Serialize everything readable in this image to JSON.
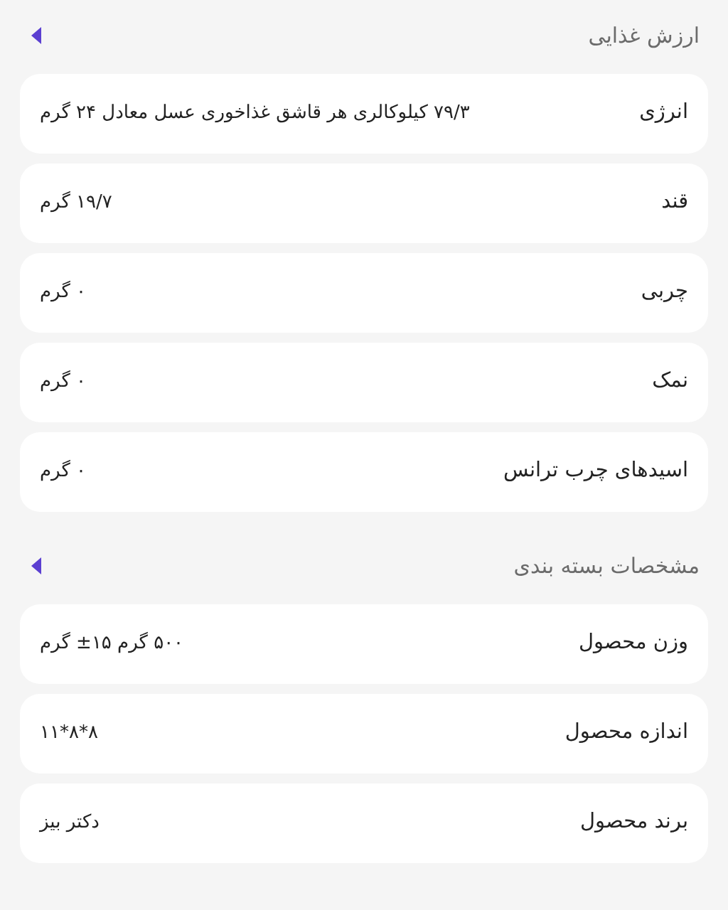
{
  "sections": [
    {
      "title": "ارزش غذایی",
      "rows": [
        {
          "label": "انرژی",
          "value": "۷۹/۳ کیلوکالری هر قاشق غذاخوری عسل معادل ۲۴ گرم"
        },
        {
          "label": "قند",
          "value": "۱۹/۷ گرم"
        },
        {
          "label": "چربی",
          "value": "۰ گرم"
        },
        {
          "label": "نمک",
          "value": "۰ گرم"
        },
        {
          "label": "اسیدهای چرب ترانس",
          "value": "۰ گرم"
        }
      ]
    },
    {
      "title": "مشخصات بسته بندی",
      "rows": [
        {
          "label": "وزن محصول",
          "value": "۵۰۰ گرم ۱۵± گرم"
        },
        {
          "label": "اندازه محصول",
          "value": "۸*۸*۱۱"
        },
        {
          "label": "برند محصول",
          "value": "دکتر بیز"
        }
      ]
    }
  ]
}
